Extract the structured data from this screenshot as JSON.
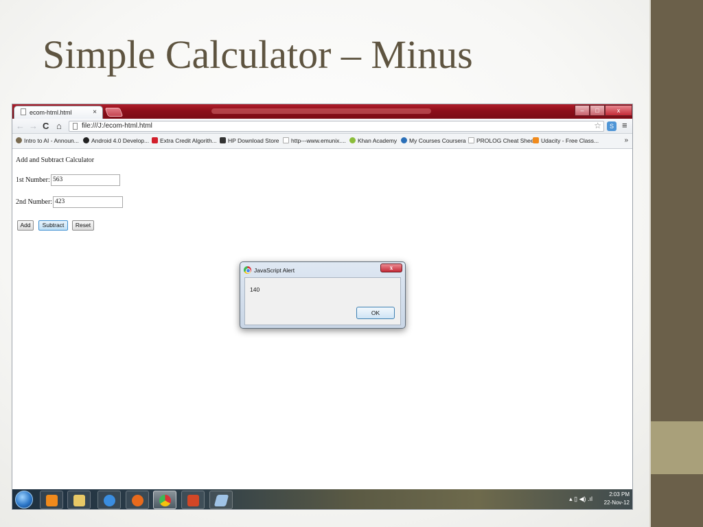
{
  "slide": {
    "title": "Simple Calculator – Minus"
  },
  "browser": {
    "tab_title": "ecom-html.html",
    "tab_close": "×",
    "window_buttons": {
      "minimize": "–",
      "maximize": "□",
      "close": "x"
    },
    "nav": {
      "back": "←",
      "forward": "→",
      "reload": "C",
      "home": "⌂"
    },
    "url": "file:///J:/ecom-html.html",
    "star": "☆",
    "menu": "≡",
    "bookmarks": [
      {
        "label": "Intro to AI - Announ...",
        "color": "#7a6b50"
      },
      {
        "label": "Android 4.0 Develop...",
        "color": "#222222"
      },
      {
        "label": "Extra Credit Algorith...",
        "color": "#d21f2b"
      },
      {
        "label": "HP Download Store",
        "color": "#333333"
      },
      {
        "label": "http---www.emunix....",
        "color": "#bbbbbb"
      },
      {
        "label": "Khan Academy",
        "color": "#8bbd3a"
      },
      {
        "label": "My Courses Coursera",
        "color": "#2a6fb8"
      },
      {
        "label": "PROLOG Cheat Sheet",
        "color": "#bbbbbb"
      },
      {
        "label": "Udacity - Free Class...",
        "color": "#f08a1c"
      }
    ],
    "bookmarks_more": "»"
  },
  "page": {
    "heading": "Add and Subtract Calculator",
    "first_label": "1st Number:",
    "first_value": "563",
    "second_label": "2nd Number:",
    "second_value": "423",
    "add_label": "Add",
    "subtract_label": "Subtract",
    "reset_label": "Reset"
  },
  "alert": {
    "title": "JavaScript Alert",
    "close": "x",
    "message": "140",
    "ok_label": "OK"
  },
  "taskbar": {
    "time": "2:03 PM",
    "date": "22-Nov-12",
    "tray_icons": "▴ ▯ ◀) .ıl"
  }
}
